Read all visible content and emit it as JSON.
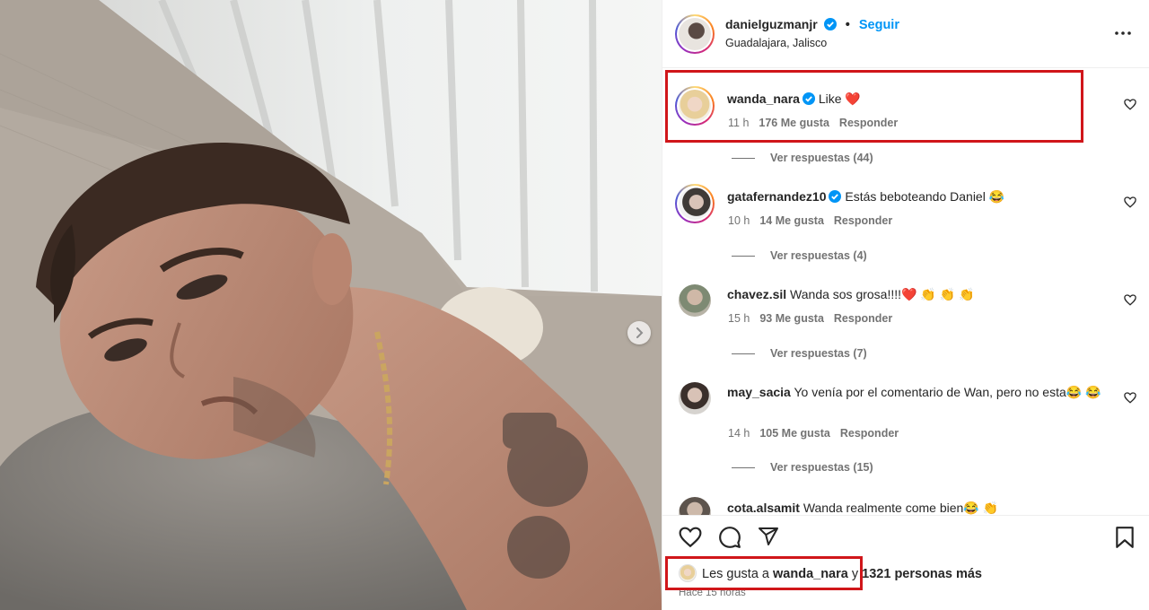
{
  "post": {
    "author": "danielguzmanjr",
    "follow_label": "Seguir",
    "location": "Guadalajara, Jalisco",
    "likes_prefix": "Les gusta a",
    "likes_user": "wanda_nara",
    "likes_connector": "y",
    "likes_rest": "1321 personas más",
    "time_ago": "Hace 15 horas"
  },
  "comments": [
    {
      "user": "wanda_nara",
      "verified": true,
      "text": "Like ❤️",
      "time": "11 h",
      "likes": "176 Me gusta",
      "reply": "Responder",
      "replies": "Ver respuestas (44)"
    },
    {
      "user": "gatafernandez10",
      "verified": true,
      "text": "Estás beboteando Daniel 😂",
      "time": "10 h",
      "likes": "14 Me gusta",
      "reply": "Responder",
      "replies": "Ver respuestas (4)"
    },
    {
      "user": "chavez.sil",
      "verified": false,
      "text": "Wanda sos grosa!!!!❤️ 👏 👏 👏",
      "time": "15 h",
      "likes": "93 Me gusta",
      "reply": "Responder",
      "replies": "Ver respuestas (7)"
    },
    {
      "user": "may_sacia",
      "verified": false,
      "text": "Yo venía por el comentario de Wan, pero no esta😂 😂",
      "time": "14 h",
      "likes": "105 Me gusta",
      "reply": "Responder",
      "replies": "Ver respuestas (15)"
    },
    {
      "user": "cota.alsamit",
      "verified": false,
      "text": "Wanda realmente come bien😂 👏"
    }
  ],
  "icons": {
    "verified": "verified-badge-icon",
    "heart": "heart-icon",
    "comment": "comment-icon",
    "share": "share-icon",
    "save": "bookmark-icon",
    "more": "more-options-icon",
    "next": "chevron-right-icon"
  },
  "colors": {
    "accent": "#0095f6",
    "highlight": "#d0161a",
    "muted": "#737373"
  }
}
